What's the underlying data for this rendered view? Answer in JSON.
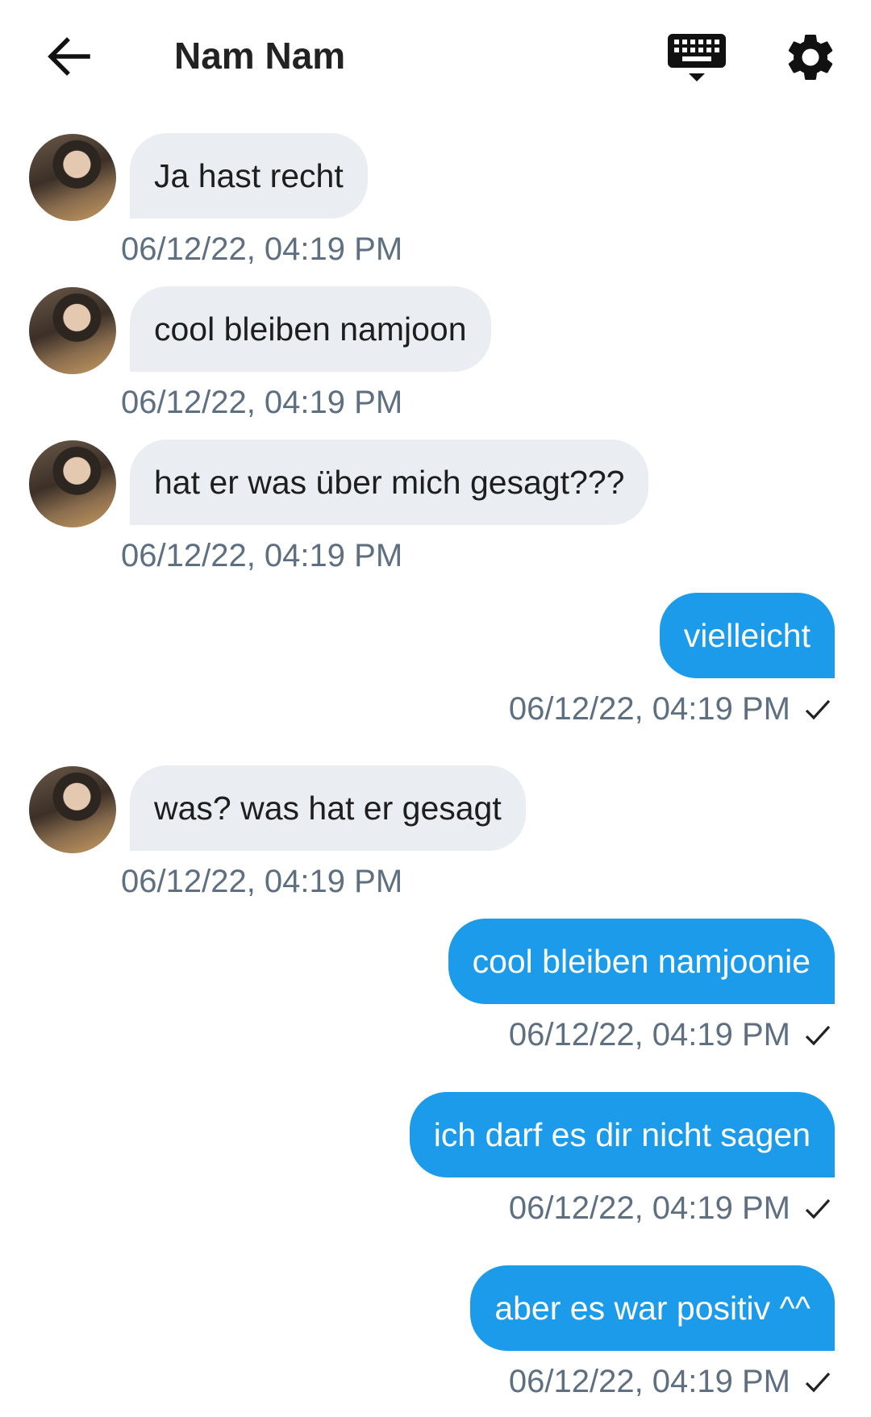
{
  "header": {
    "title": "Nam Nam",
    "back_icon": "arrow-left-icon",
    "keyboard_icon": "keyboard-icon",
    "settings_icon": "gear-icon"
  },
  "colors": {
    "incoming_bubble": "#eaedf1",
    "outgoing_bubble": "#1b9bea",
    "timestamp": "#5d6f80"
  },
  "messages": [
    {
      "direction": "in",
      "text": "Ja hast recht",
      "time": "06/12/22, 04:19 PM"
    },
    {
      "direction": "in",
      "text": "cool bleiben namjoon",
      "time": "06/12/22, 04:19 PM"
    },
    {
      "direction": "in",
      "text": "hat er was über mich gesagt???",
      "time": "06/12/22, 04:19 PM"
    },
    {
      "direction": "out",
      "text": "vielleicht",
      "time": "06/12/22, 04:19 PM",
      "status": "sent"
    },
    {
      "direction": "in",
      "text": "was? was hat er gesagt",
      "time": "06/12/22, 04:19 PM"
    },
    {
      "direction": "out",
      "text": "cool bleiben namjoonie",
      "time": "06/12/22, 04:19 PM",
      "status": "sent"
    },
    {
      "direction": "out",
      "text": "ich darf es dir nicht sagen",
      "time": "06/12/22, 04:19 PM",
      "status": "sent"
    },
    {
      "direction": "out",
      "text": "aber es war positiv ^^",
      "time": "06/12/22, 04:19 PM",
      "status": "sent"
    }
  ]
}
